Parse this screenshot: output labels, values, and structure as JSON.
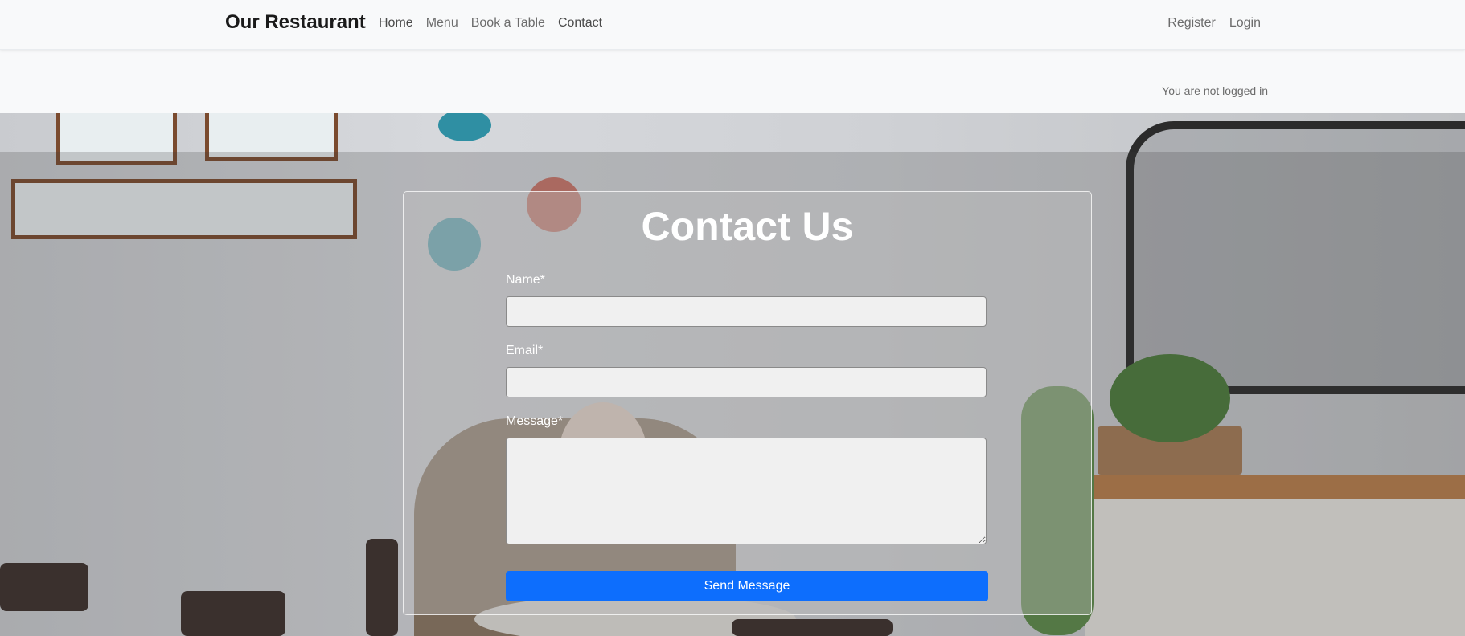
{
  "navbar": {
    "brand": "Our Restaurant",
    "left_links": [
      "Home",
      "Menu",
      "Book a Table",
      "Contact"
    ],
    "right_links": [
      "Register",
      "Login"
    ]
  },
  "status": {
    "text": "You are not logged in"
  },
  "contact": {
    "title": "Contact Us",
    "name_label": "Name*",
    "email_label": "Email*",
    "message_label": "Message*",
    "name_value": "",
    "email_value": "",
    "message_value": "",
    "submit_label": "Send Message"
  },
  "colors": {
    "primary_button": "#0d6efd",
    "navbar_bg": "#f8f9fa"
  }
}
